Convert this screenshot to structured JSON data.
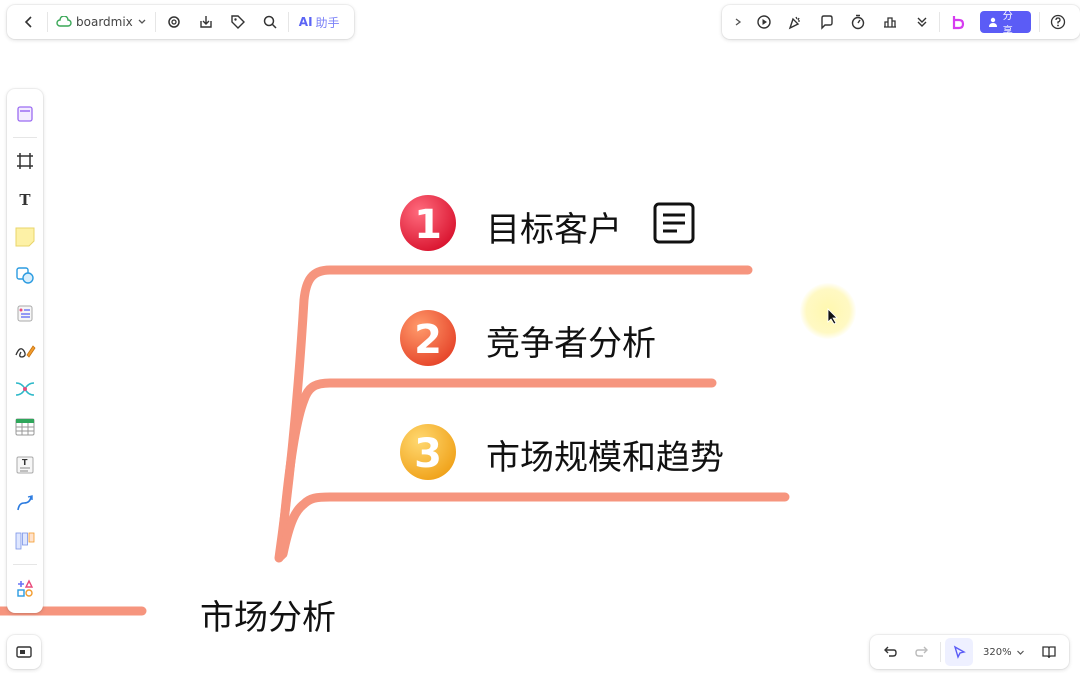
{
  "top_bar": {
    "app_name": "boardmix",
    "ai_label": "AI",
    "ai_sub": "助手",
    "share_label": "分享"
  },
  "mindmap": {
    "root": "市场分析",
    "branches": [
      {
        "number": "1",
        "label": "目标客户"
      },
      {
        "number": "2",
        "label": "竞争者分析"
      },
      {
        "number": "3",
        "label": "市场规模和趋势"
      }
    ]
  },
  "bottom_bar": {
    "zoom": "320%"
  },
  "colors": {
    "branch_line": "#f6957e",
    "badge_1": "#e8233c",
    "badge_2": "#f0583a",
    "badge_3": "#f7b324",
    "accent": "#5b5cf6"
  }
}
